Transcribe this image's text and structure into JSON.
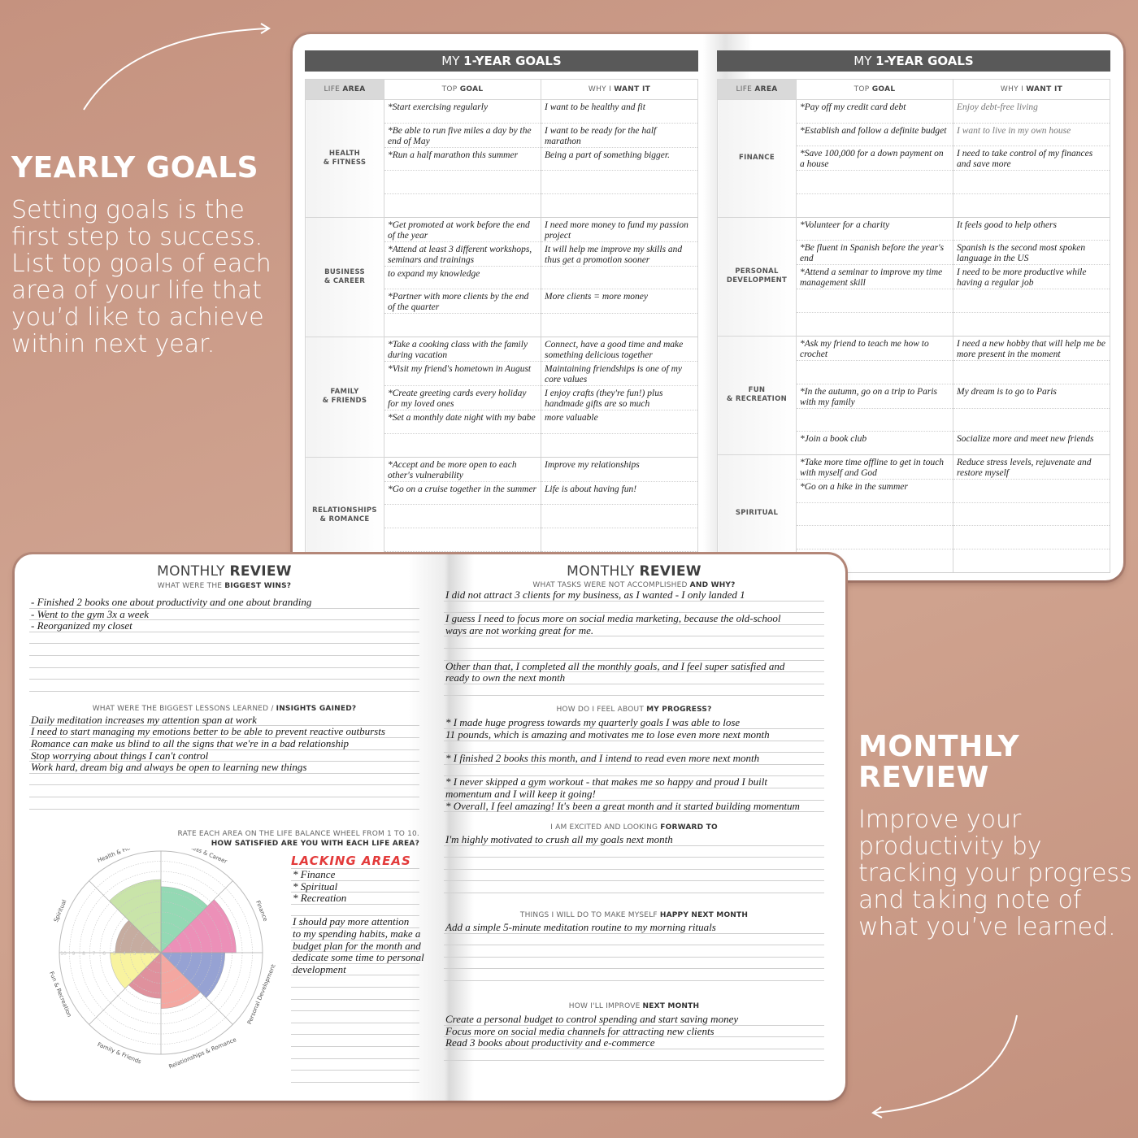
{
  "promo": {
    "yearly": {
      "title": "YEARLY GOALS",
      "body": "Setting goals is the first step to success. List top goals of each area of your life that you’d like to achieve within next year."
    },
    "monthly": {
      "title": "MONTHLY REVIEW",
      "body": "Improve your productivity by tracking your progress and taking note of what you’ve learned."
    }
  },
  "goals": {
    "banner_prefix": "MY",
    "banner_bold": "1-YEAR GOALS",
    "headers": {
      "area": [
        "LIFE ",
        "AREA"
      ],
      "goal": [
        "TOP ",
        "GOAL"
      ],
      "why": [
        "WHY I ",
        "WANT IT"
      ]
    },
    "left_areas": [
      {
        "label_lines": [
          "HEALTH",
          "& FITNESS"
        ],
        "rows": [
          {
            "goal": "*Start exercising regularly",
            "why": "I want to be healthy and fit"
          },
          {
            "goal": "*Be able to run five miles a day by the end of May",
            "why": "I want to be ready for the half marathon"
          },
          {
            "goal": "*Run a half marathon this summer",
            "why": "Being a part of something bigger."
          },
          {
            "goal": "",
            "why": ""
          },
          {
            "goal": "",
            "why": ""
          }
        ]
      },
      {
        "label_lines": [
          "BUSINESS",
          "& CAREER"
        ],
        "rows": [
          {
            "goal": "*Get promoted at work before the end of the year",
            "why": "I need more money to fund my passion project"
          },
          {
            "goal": "*Attend at least 3 different workshops, seminars and trainings",
            "why": "It will help me improve my skills and thus get a promotion sooner"
          },
          {
            "goal": "to expand my knowledge",
            "why": ""
          },
          {
            "goal": "*Partner with more clients by the end of the quarter",
            "why": "More clients = more money"
          },
          {
            "goal": "",
            "why": ""
          }
        ]
      },
      {
        "label_lines": [
          "FAMILY",
          "& FRIENDS"
        ],
        "rows": [
          {
            "goal": "*Take a cooking class with the family during vacation",
            "why": "Connect, have a good time and make something delicious together"
          },
          {
            "goal": "*Visit my friend's hometown in August",
            "why": "Maintaining friendships is one of my core values"
          },
          {
            "goal": "*Create greeting cards every holiday for my loved ones",
            "why": "I enjoy crafts (they're fun!) plus handmade gifts are so much"
          },
          {
            "goal": "*Set a monthly date night with my babe",
            "why": "more valuable"
          },
          {
            "goal": "",
            "why": ""
          }
        ]
      },
      {
        "label_lines": [
          "RELATIONSHIPS",
          "& ROMANCE"
        ],
        "rows": [
          {
            "goal": "*Accept and be more open to each other's vulnerability",
            "why": "Improve my relationships"
          },
          {
            "goal": "*Go on a cruise together in the summer",
            "why": "Life is about having fun!"
          },
          {
            "goal": "",
            "why": ""
          },
          {
            "goal": "",
            "why": ""
          },
          {
            "goal": "",
            "why": ""
          }
        ]
      }
    ],
    "right_areas": [
      {
        "label_lines": [
          "FINANCE"
        ],
        "rows": [
          {
            "goal": "*Pay off my credit card debt",
            "why": "Enjoy debt-free living",
            "light": true
          },
          {
            "goal": "*Establish and follow a definite budget",
            "why": "I want to live in my own house",
            "light": true
          },
          {
            "goal": "*Save 100,000 for a down payment on a house",
            "why": "I need to take control of my finances and save more"
          },
          {
            "goal": "",
            "why": ""
          },
          {
            "goal": "",
            "why": ""
          }
        ]
      },
      {
        "label_lines": [
          "PERSONAL",
          "DEVELOPMENT"
        ],
        "rows": [
          {
            "goal": "*Volunteer for a charity",
            "why": "It feels good to help others"
          },
          {
            "goal": "*Be fluent in Spanish before the year's end",
            "why": "Spanish is the second most spoken language in the US"
          },
          {
            "goal": "*Attend a seminar to improve my time management skill",
            "why": "I need to be more productive while having a regular job"
          },
          {
            "goal": "",
            "why": ""
          },
          {
            "goal": "",
            "why": ""
          }
        ]
      },
      {
        "label_lines": [
          "FUN",
          "& RECREATION"
        ],
        "rows": [
          {
            "goal": "*Ask my friend to teach me how to crochet",
            "why": "I need a new hobby that will help me be more present in the moment"
          },
          {
            "goal": "",
            "why": ""
          },
          {
            "goal": "*In the autumn, go on a trip to Paris with my family",
            "why": "My dream is to go to Paris"
          },
          {
            "goal": "",
            "why": ""
          },
          {
            "goal": "*Join a book club",
            "why": "Socialize more and meet new friends"
          }
        ]
      },
      {
        "label_lines": [
          "SPIRITUAL"
        ],
        "rows": [
          {
            "goal": "*Take more time offline to get in touch with myself and God",
            "why": "Reduce stress levels, rejuvenate and restore myself"
          },
          {
            "goal": "*Go on a hike in the summer",
            "why": ""
          },
          {
            "goal": "",
            "why": ""
          },
          {
            "goal": "",
            "why": ""
          },
          {
            "goal": "",
            "why": ""
          }
        ]
      }
    ]
  },
  "monthly_review": {
    "title_prefix": "MONTHLY",
    "title_bold": "REVIEW",
    "left": {
      "wins_q": [
        "WHAT WERE THE ",
        "BIGGEST WINS?"
      ],
      "wins": [
        "- Finished 2 books one about productivity and one about branding",
        " - Went to the gym 3x a week",
        " - Reorganized my closet",
        "",
        "",
        "",
        "",
        ""
      ],
      "lessons_q": [
        "WHAT WERE THE BIGGEST LESSONS LEARNED / ",
        "INSIGHTS GAINED?"
      ],
      "lessons": [
        "Daily meditation increases my attention span at work",
        "I need to start managing my emotions better to be able to prevent reactive outbursts",
        "Romance can make us blind to all the signs that we're in a bad relationship",
        "Stop worrying about things I can't control",
        "Work hard, dream big and always be open to learning new things",
        "",
        "",
        ""
      ],
      "wheel_q1": "RATE EACH AREA ON THE LIFE BALANCE WHEEL FROM 1 TO 10.",
      "wheel_q2": "HOW SATISFIED ARE YOU WITH EACH LIFE AREA?",
      "lacking_title": "LACKING AREAS",
      "lacking": [
        "* Finance",
        "* Spiritual",
        "* Recreation"
      ],
      "notes": [
        "",
        "I should pay more attention",
        "to my spending habits, make a",
        "budget plan for the month and",
        "dedicate some time to personal",
        "development",
        "",
        "",
        "",
        "",
        "",
        "",
        "",
        "",
        ""
      ]
    },
    "right": {
      "not_done_q": [
        "WHAT TASKS WERE NOT ACCOMPLISHED ",
        "AND WHY?"
      ],
      "not_done": [
        "I did not attract 3 clients for my business, as I wanted - I only landed 1",
        "",
        "I guess I need to focus more on social media marketing, because the old-school",
        "ways are not working great for me.",
        "",
        "",
        "Other than that, I completed all the monthly goals, and I feel super satisfied and",
        "ready to own the next month",
        ""
      ],
      "progress_q": [
        "HOW DO I FEEL ABOUT ",
        "MY PROGRESS?"
      ],
      "progress": [
        "* I made huge progress towards my quarterly goals I was able to lose",
        "11 pounds, which is amazing and motivates me to lose even more next month",
        "",
        "* I finished 2 books this month, and I intend to read even more next month",
        "",
        "* I never skipped a gym workout - that makes me so happy and proud I built",
        "momentum and I will keep it going!",
        "* Overall, I feel amazing! It's been a great month and it started building momentum"
      ],
      "forward_q": [
        "I AM EXCITED AND LOOKING ",
        "FORWARD TO"
      ],
      "forward": [
        "I'm highly motivated to crush all my goals next month",
        "",
        "",
        "",
        ""
      ],
      "happy_q": [
        "THINGS I WILL DO TO MAKE MYSELF ",
        "HAPPY NEXT MONTH"
      ],
      "happy": [
        "Add a simple 5-minute meditation routine to my morning rituals",
        "",
        "",
        "",
        ""
      ],
      "improve_q": [
        "HOW I'LL IMPROVE ",
        "NEXT MONTH"
      ],
      "improve": [
        "Create a personal budget to control spending and start saving money",
        " Focus more on social media channels for attracting new clients",
        " Read 3 books about productivity and e-commerce",
        ""
      ]
    }
  },
  "chart_data": {
    "type": "polar-area",
    "title": "Life Balance Wheel",
    "scale": [
      1,
      10
    ],
    "tick_labels": [
      "10",
      "9",
      "8",
      "7",
      "6",
      "5",
      "4",
      "3",
      "2",
      "1"
    ],
    "categories": [
      "Business & Career",
      "Finance",
      "Personal Development",
      "Relationships & Romance",
      "Family & Friends",
      "Fun & Recreation",
      "Spiritual",
      "Health & Fitness"
    ],
    "values": [
      6.5,
      7.4,
      6.3,
      5.5,
      4.5,
      5,
      4.5,
      7.2
    ],
    "colors": [
      "#8fd8b0",
      "#ec8bb5",
      "#919ed1",
      "#f4a39c",
      "#de8c98",
      "#f8f39a",
      "#c3a89b",
      "#c7e3a5"
    ]
  }
}
